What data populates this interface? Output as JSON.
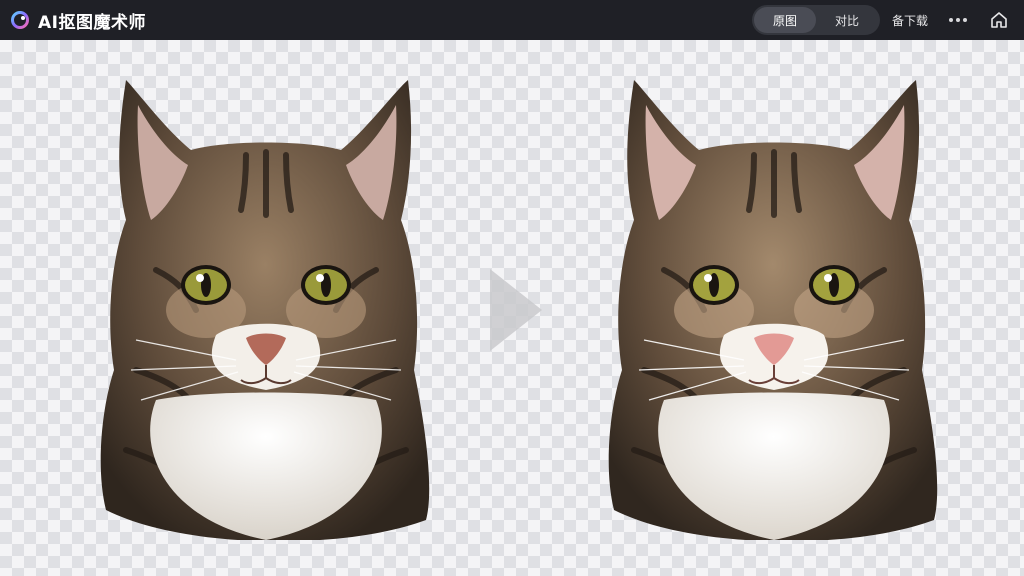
{
  "app": {
    "title": "AI抠图魔术师"
  },
  "header": {
    "toggle": {
      "original_label": "原图",
      "compare_label": "对比",
      "active": "original"
    },
    "download_label": "备下载",
    "icons": {
      "logo": "ring-logo-icon",
      "more": "more-horizontal-icon",
      "home": "home-icon"
    }
  },
  "canvas": {
    "background": "transparent-checkerboard",
    "images": [
      {
        "name": "original-cat-cutout"
      },
      {
        "name": "processed-cat-cutout"
      }
    ]
  },
  "colors": {
    "topbar": "#1f2026",
    "toggle_bg": "#34363d",
    "toggle_active": "#4a4c55",
    "fur_dark": "#3a2f25",
    "fur_mid": "#7a6450",
    "fur_light": "#c9b39a",
    "chest": "#f2efea",
    "eye": "#9a9a3a",
    "nose_original": "#b36a5a",
    "nose_processed": "#e39a95"
  }
}
